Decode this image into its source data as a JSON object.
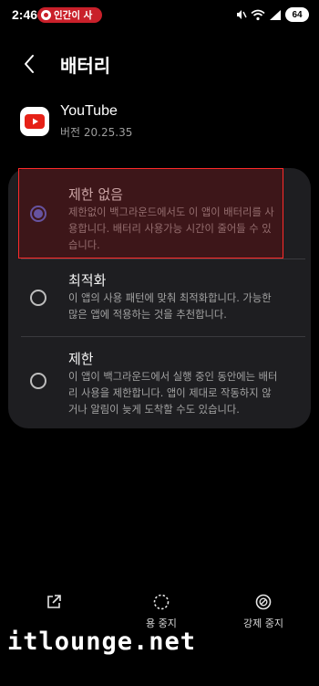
{
  "status_bar": {
    "time": "2:46",
    "live_pill": "인간이 사",
    "battery": "64",
    "icons": [
      "mute-icon",
      "wifi-icon",
      "signal-icon",
      "battery-icon"
    ]
  },
  "header": {
    "back_icon": "chevron-left-icon",
    "title": "배터리"
  },
  "app": {
    "icon": "youtube-icon",
    "name": "YouTube",
    "version": "버전 20.25.35"
  },
  "options": [
    {
      "title": "제한 없음",
      "description": "제한없이 백그라운드에서도 이 앱이 배터리를 사용합니다. 배터리 사용가능 시간이 줄어들 수 있습니다.",
      "selected": true
    },
    {
      "title": "최적화",
      "description": "이 앱의 사용 패턴에 맞춰 최적화합니다. 가능한 많은 앱에 적용하는 것을 추천합니다.",
      "selected": false
    },
    {
      "title": "제한",
      "description": "이 앱이 백그라운드에서 실행 중인 동안에는 배터리 사용을 제한합니다. 앱이 제대로 작동하지 않거나 알림이 늦게 도착할 수도 있습니다.",
      "selected": false
    }
  ],
  "bottom_bar": {
    "actions": [
      {
        "icon": "open-external-icon",
        "label": ""
      },
      {
        "icon": "dotted-circle-icon",
        "label": "용 중지"
      },
      {
        "icon": "block-icon",
        "label": "강제 중지"
      }
    ]
  },
  "watermark": "itlounge.net",
  "colors": {
    "background": "#000000",
    "card": "#1e1e21",
    "accent": "#5f7bf0",
    "highlight_border": "#ff2a2a",
    "live_pill": "#c9202a"
  }
}
